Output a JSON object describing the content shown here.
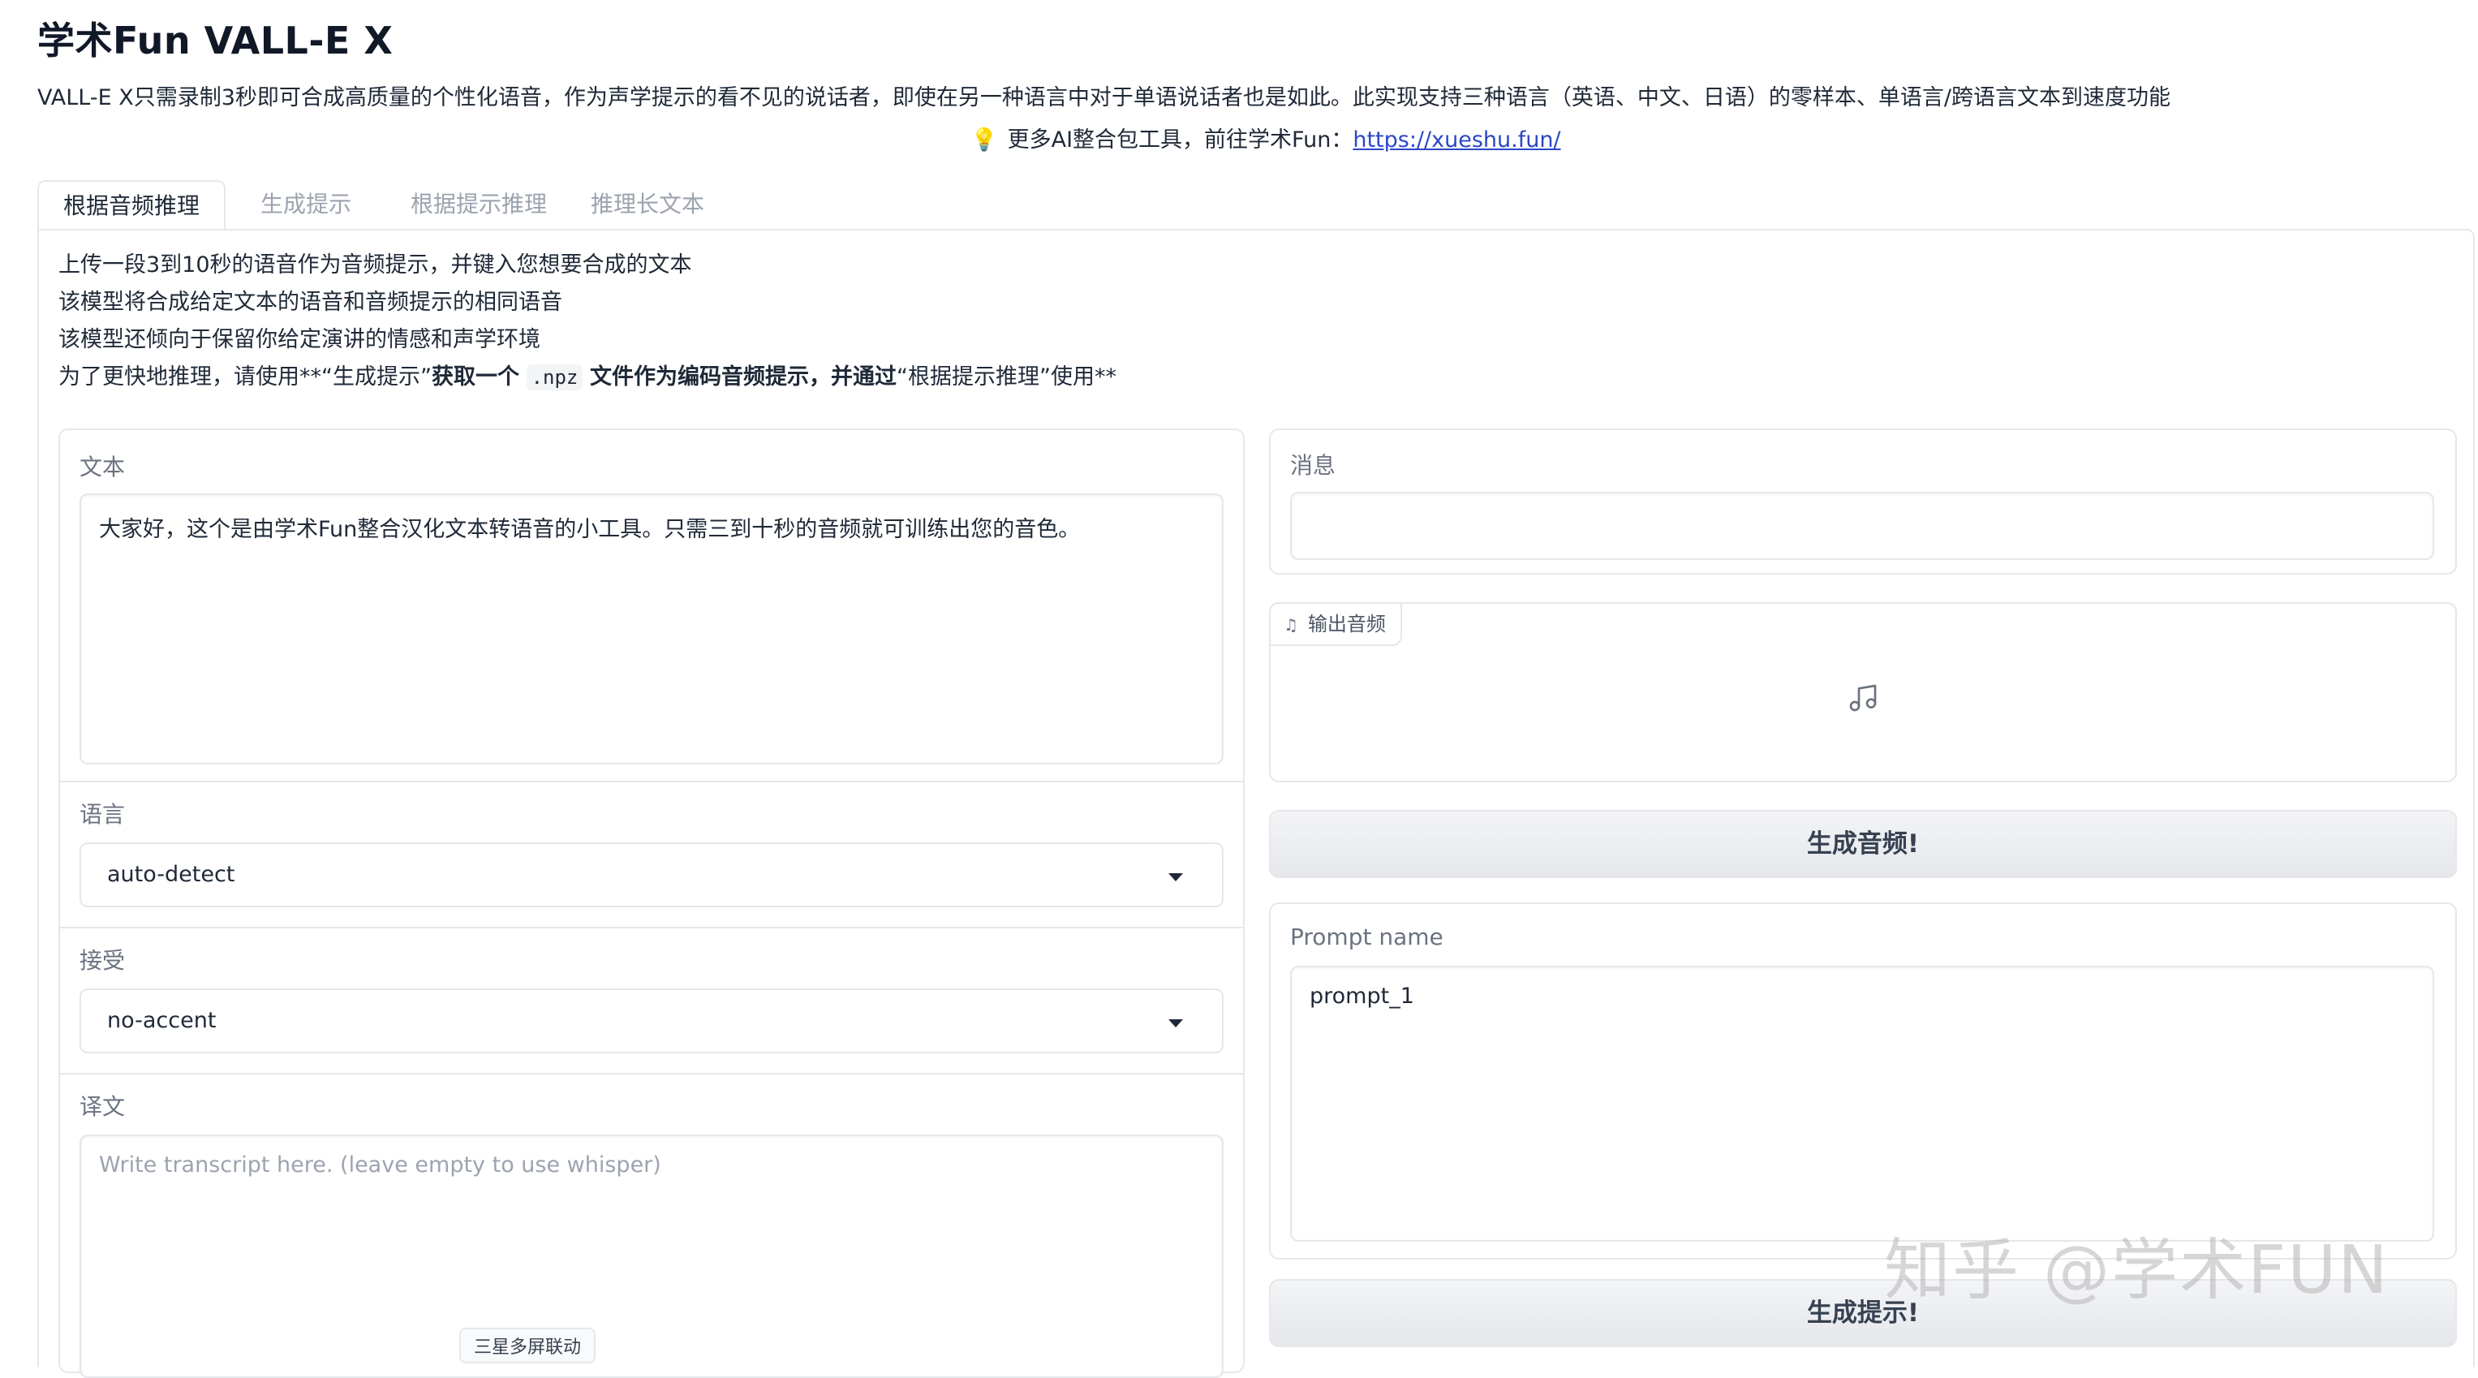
{
  "header": {
    "title": "学术Fun VALL-E X",
    "description": "VALL-E X只需录制3秒即可合成高质量的个性化语音，作为声学提示的看不见的说话者，即使在另一种语言中对于单语说话者也是如此。此实现支持三种语言（英语、中文、日语）的零样本、单语言/跨语言文本到速度功能",
    "tip_text": "更多AI整合包工具，前往学术Fun：",
    "tip_link": "https://xueshu.fun/"
  },
  "tabs": [
    {
      "label": "根据音频推理",
      "active": true
    },
    {
      "label": "生成提示",
      "active": false
    },
    {
      "label": "根据提示推理",
      "active": false
    },
    {
      "label": "推理长文本",
      "active": false
    }
  ],
  "intro": {
    "line1": "上传一段3到10秒的语音作为音频提示，并键入您想要合成的文本",
    "line2": "该模型将合成给定文本的语音和音频提示的相同语音",
    "line3": "该模型还倾向于保留你给定演讲的情感和声学环境",
    "line4_a": "为了更快地推理，请使用**“生成提示”",
    "line4_b": "获取一个",
    "line4_code": ".npz",
    "line4_c": "文件作为编码音频提示，并通过",
    "line4_d": "“根据提示推理”使用**"
  },
  "left_panel": {
    "text_label": "文本",
    "text_value": "大家好，这个是由学术Fun整合汉化文本转语音的小工具。只需三到十秒的音频就可训练出您的音色。",
    "language_label": "语言",
    "language_value": "auto-detect",
    "accent_label": "接受",
    "accent_value": "no-accent",
    "transcript_label": "译文",
    "transcript_placeholder": "Write transcript here. (leave empty to use whisper)"
  },
  "right_panel": {
    "message_label": "消息",
    "message_value": "",
    "output_audio_label": "输出音频",
    "generate_audio_button": "生成音频!",
    "prompt_name_label": "Prompt name",
    "prompt_name_value": "prompt_1",
    "generate_prompt_button": "生成提示!"
  },
  "overlay": {
    "watermark": "知乎 @学术FUN",
    "floating_tag": "三星多屏联动"
  },
  "icons": {
    "tip": "lightbulb-icon",
    "audio_tag": "music-note-icon",
    "audio_placeholder": "music-icon",
    "dropdown": "chevron-down-icon"
  },
  "colors": {
    "link": "#2b46c7",
    "border": "#e5e7eb",
    "button_bg": "#e5e7eb"
  }
}
